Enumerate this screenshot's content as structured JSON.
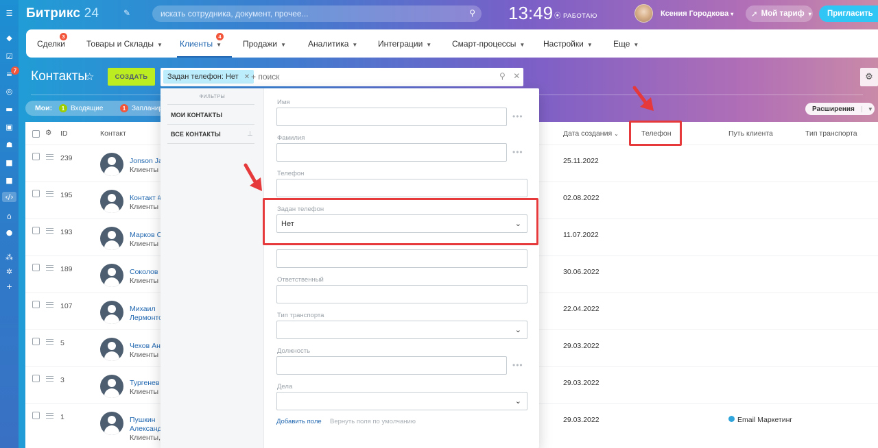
{
  "header": {
    "logo_text": "Битрикс",
    "logo_num": "24",
    "search_placeholder": "искать сотрудника, документ, прочее...",
    "clock": "13:49",
    "work_status": "РАБОТАЮ",
    "user_name": "Ксения Городкова",
    "tariff_label": "Мой тариф",
    "invite_label": "Пригласить"
  },
  "rail": {
    "badge": "7"
  },
  "menu": {
    "items": [
      {
        "label": "Сделки",
        "badge": "3"
      },
      {
        "label": "Товары и Склады"
      },
      {
        "label": "Клиенты",
        "badge": "4"
      },
      {
        "label": "Продажи"
      },
      {
        "label": "Аналитика"
      },
      {
        "label": "Интеграции"
      },
      {
        "label": "Смарт-процессы"
      },
      {
        "label": "Настройки"
      },
      {
        "label": "Еще"
      }
    ]
  },
  "toolbar": {
    "title": "Контакты",
    "create_label": "СОЗДАТЬ",
    "filter_chip": "Задан телефон: Нет",
    "search_placeholder": "+ поиск"
  },
  "counters": {
    "mine_label": "Мои:",
    "incoming_count": "1",
    "incoming_label": "Входящие",
    "planned_count": "1",
    "planned_label": "Запланир",
    "extensions_label": "Расширения"
  },
  "table": {
    "columns": {
      "id": "ID",
      "contact": "Контакт",
      "created": "Дата создания",
      "phone": "Телефон",
      "path": "Путь клиента",
      "transport": "Тип транспорта"
    },
    "rows": [
      {
        "id": "239",
        "name": "Jonson Jac",
        "type": "Клиенты",
        "date": "25.11.2022",
        "path": ""
      },
      {
        "id": "195",
        "name": "Контакт #",
        "type": "Клиенты",
        "date": "02.08.2022",
        "path": ""
      },
      {
        "id": "193",
        "name": "Марков С",
        "type": "Клиенты",
        "date": "11.07.2022",
        "path": ""
      },
      {
        "id": "189",
        "name": "Соколов В",
        "type": "Клиенты",
        "date": "30.06.2022",
        "path": ""
      },
      {
        "id": "107",
        "name": "Михаил",
        "type": "Лермонто",
        "date": "22.04.2022",
        "path": ""
      },
      {
        "id": "5",
        "name": "Чехов Ант",
        "type": "Клиенты",
        "date": "29.03.2022",
        "path": ""
      },
      {
        "id": "3",
        "name": "Тургенев",
        "type": "Клиенты",
        "date": "29.03.2022",
        "path": ""
      },
      {
        "id": "1",
        "name": "Пушкин",
        "type": "Александ",
        "type2": "Клиенты, (",
        "date": "29.03.2022",
        "path": "Email Маркетинг"
      }
    ]
  },
  "filter_popup": {
    "presets_title": "ФИЛЬТРЫ",
    "preset_my": "МОИ КОНТАКТЫ",
    "preset_all": "ВСЕ КОНТАКТЫ",
    "fields": {
      "name": "Имя",
      "surname": "Фамилия",
      "phone": "Телефон",
      "phone_set": "Задан телефон",
      "phone_set_value": "Нет",
      "responsible": "Ответственный",
      "transport": "Тип транспорта",
      "position": "Должность",
      "deals": "Дела"
    },
    "add_field": "Добавить поле",
    "reset_fields": "Вернуть поля по умолчанию"
  },
  "colors": {
    "accent": "#2066b0",
    "create_button": "#bbed21",
    "highlight": "#e5393b",
    "badge": "#f2553a",
    "invite": "#2fc6f6"
  }
}
